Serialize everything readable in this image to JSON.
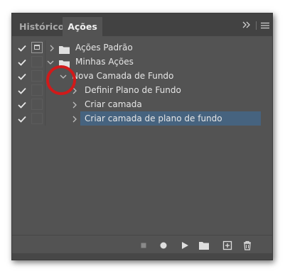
{
  "tabs": [
    {
      "label": "Histórico",
      "active": false
    },
    {
      "label": "Ações",
      "active": true
    }
  ],
  "header_icons": [
    "collapse-icon",
    "panel-menu-icon"
  ],
  "rows": [
    {
      "label": "Ações Padrão",
      "level": 0,
      "kind": "set",
      "expanded": false,
      "checked": true,
      "modal": true
    },
    {
      "label": "Minhas Ações",
      "level": 0,
      "kind": "set",
      "expanded": true,
      "checked": true,
      "modal": false
    },
    {
      "label": "Nova Camada de Fundo",
      "level": 1,
      "kind": "action",
      "expanded": true,
      "checked": true,
      "modal": false
    },
    {
      "label": "Definir Plano de Fundo",
      "level": 2,
      "kind": "step",
      "expanded": false,
      "checked": true,
      "modal": false
    },
    {
      "label": "Criar camada",
      "level": 2,
      "kind": "step",
      "expanded": false,
      "checked": true,
      "modal": false
    },
    {
      "label": "Criar camada de plano de fundo",
      "level": 2,
      "kind": "step",
      "expanded": false,
      "checked": true,
      "modal": false,
      "selected": true
    }
  ],
  "footer_icons": [
    "stop-icon",
    "record-icon",
    "play-icon",
    "new-set-folder-icon",
    "new-action-icon",
    "delete-icon"
  ],
  "colors": {
    "panel_bg": "#535353",
    "tabbar_bg": "#424242",
    "selection": "#46637f",
    "highlight_circle": "#d11a1a"
  }
}
